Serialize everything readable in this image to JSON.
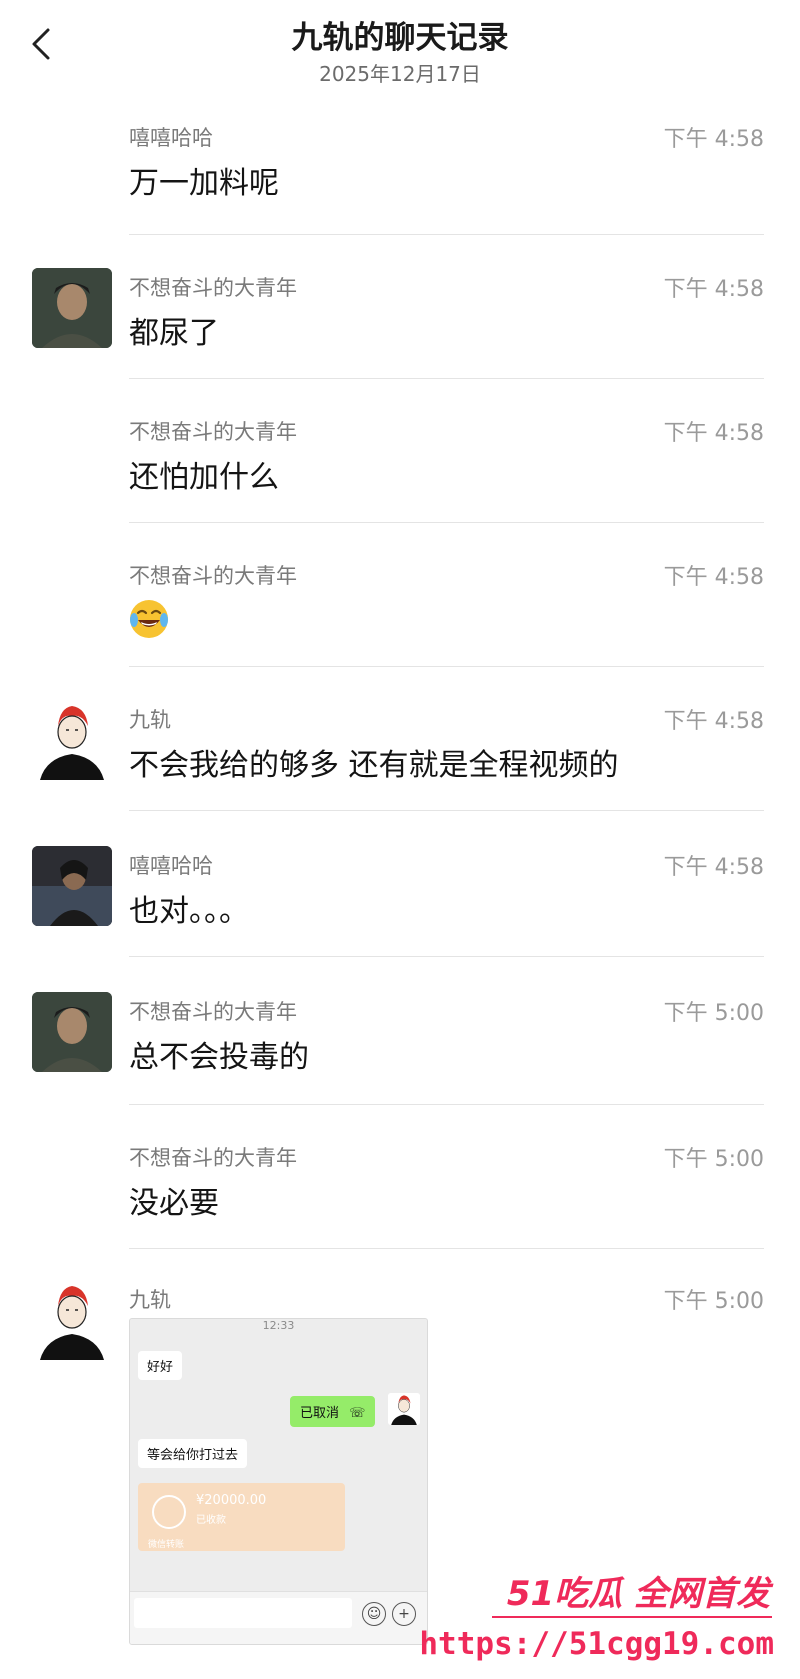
{
  "header": {
    "title": "九轨的聊天记录",
    "date": "2025年12月17日"
  },
  "messages": [
    {
      "sender": "嘻嘻哈哈",
      "time": "下午 4:58",
      "text": "万一加料呢",
      "avatar": "none"
    },
    {
      "sender": "不想奋斗的大青年",
      "time": "下午 4:58",
      "text": "都尿了",
      "avatar": "dark-portrait"
    },
    {
      "sender": "不想奋斗的大青年",
      "time": "下午 4:58",
      "text": "还怕加什么",
      "avatar": "none"
    },
    {
      "sender": "不想奋斗的大青年",
      "time": "下午 4:58",
      "text": "",
      "emoji": "laughing-crying-emoji",
      "avatar": "none"
    },
    {
      "sender": "九轨",
      "time": "下午 4:58",
      "text": "不会我给的够多 还有就是全程视频的",
      "avatar": "red-hair-cartoon"
    },
    {
      "sender": "嘻嘻哈哈",
      "time": "下午 4:58",
      "text": "也对。。。",
      "avatar": "dark-photo"
    },
    {
      "sender": "不想奋斗的大青年",
      "time": "下午 5:00",
      "text": "总不会投毒的",
      "avatar": "dark-portrait"
    },
    {
      "sender": "不想奋斗的大青年",
      "time": "下午 5:00",
      "text": "没必要",
      "avatar": "none"
    },
    {
      "sender": "九轨",
      "time": "下午 5:00",
      "text": "",
      "avatar": "red-hair-cartoon",
      "image": "chat-screenshot"
    }
  ],
  "screenshot": {
    "time": "12:33",
    "bubble1": "好好",
    "bubble_right": "已取消",
    "bubble2": "等会给你打过去",
    "transfer_amount": "¥20000.00",
    "transfer_status": "已收款",
    "transfer_label": "微信转账"
  },
  "watermark": {
    "brand": "51吃瓜 全网首发",
    "url": "https://51cgg19.com"
  },
  "colors": {
    "accent_green": "#95ec69",
    "watermark": "#ef2a5a",
    "transfer": "#f8dcc0"
  }
}
